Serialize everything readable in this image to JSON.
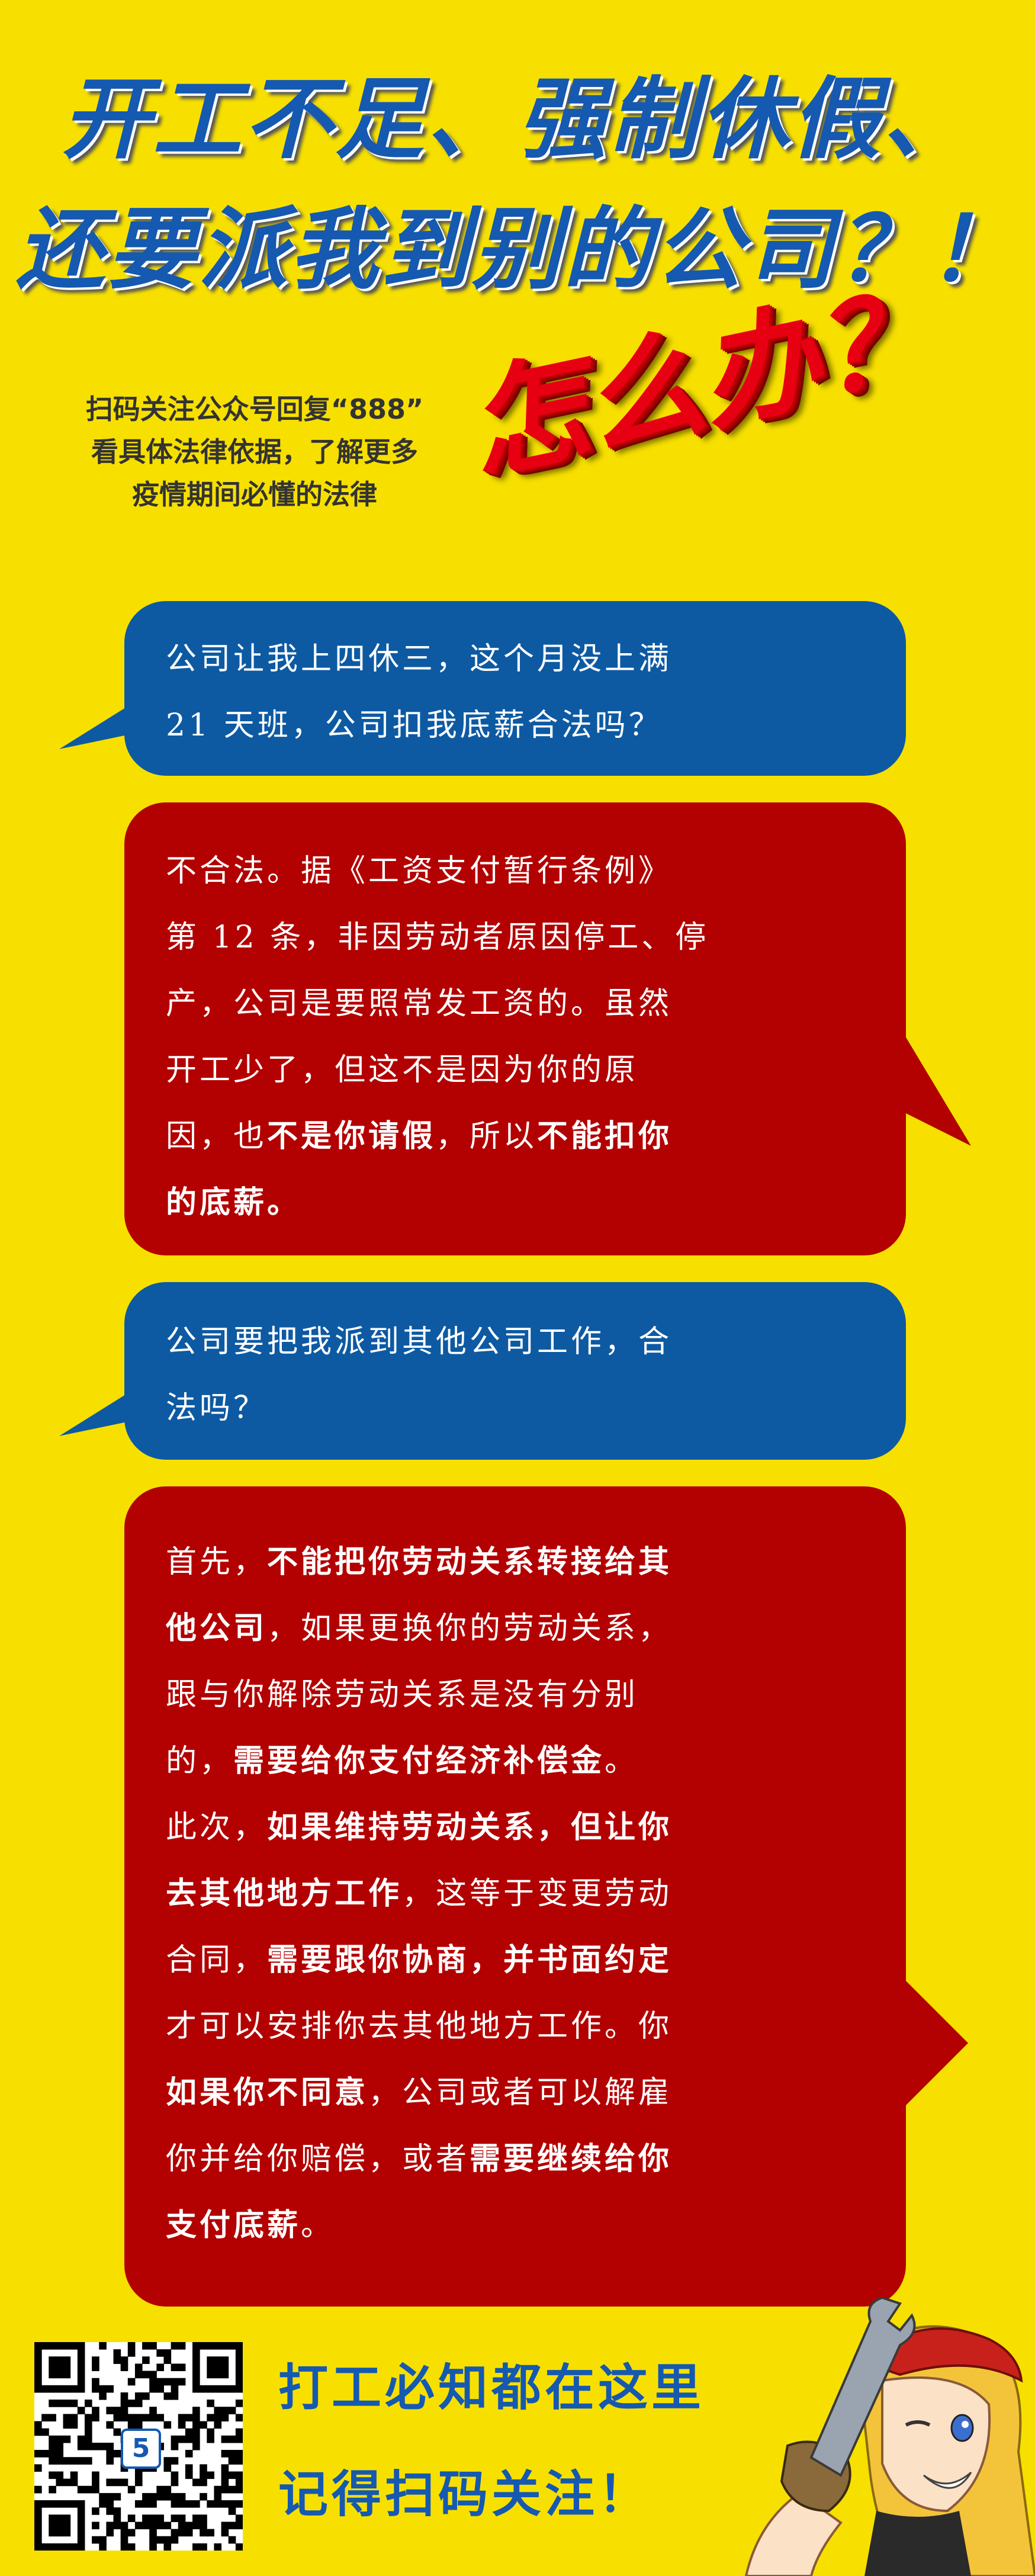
{
  "title": {
    "line1": "开工不足、强制休假、",
    "line2": "还要派我到别的公司？！",
    "what_to_do": "怎么办？"
  },
  "scan_note": {
    "line1": "扫码关注公众号回复“888”",
    "line2": "看具体法律依据，了解更多",
    "line3": "疫情期间必懂的法律"
  },
  "qa": {
    "q1": {
      "l1": "公司让我上四休三，这个月没上满",
      "l2": "21 天班，公司扣我底薪合法吗？"
    },
    "a1": {
      "l1": "不合法。据《工资支付暂行条例》",
      "l2": "第 12 条，非因劳动者原因停工、停",
      "l3": "产，公司是要照常发工资的。虽然",
      "l4": "开工少了，但这不是因为你的原",
      "l5a": "因，也",
      "l5b": "不是你请假",
      "l5c": "，所以",
      "l5d": "不能扣你",
      "l6": "的底薪。"
    },
    "q2": {
      "l1": "公司要把我派到其他公司工作，合",
      "l2": "法吗？"
    },
    "a2": {
      "l1a": "首先，",
      "l1b": "不能把你劳动关系转接给其",
      "l2a": "他公司",
      "l2b": "，如果更换你的劳动关系，",
      "l3": "跟与你解除劳动关系是没有分别",
      "l4a": "的，",
      "l4b": "需要给你支付经济补偿金",
      "l4c": "。",
      "l5a": "此次，",
      "l5b": "如果维持劳动关系，但让你",
      "l6a": "去其他地方工作",
      "l6b": "，这等于变更劳动",
      "l7a": "合同，",
      "l7b": "需要跟你协商，并书面约定",
      "l8": "才可以安排你去其他地方工作。你",
      "l9a": "如果你不同意",
      "l9b": "，公司或者可以解雇",
      "l10a": "你并给你赔偿，或者",
      "l10b": "需要继续给你",
      "l11a": "支付底薪",
      "l11b": "。"
    }
  },
  "footer": {
    "line1": "打工必知都在这里",
    "line2": "记得扫码关注！",
    "qr_logo": "5"
  },
  "colors": {
    "background": "#f7e000",
    "title_blue": "#1559b0",
    "question_blue": "#0d5aa3",
    "answer_red": "#b30000",
    "what_red": "#e60012"
  },
  "icons": {
    "qr": "qr-code-icon",
    "mascot": "wrench-mascot-icon"
  }
}
